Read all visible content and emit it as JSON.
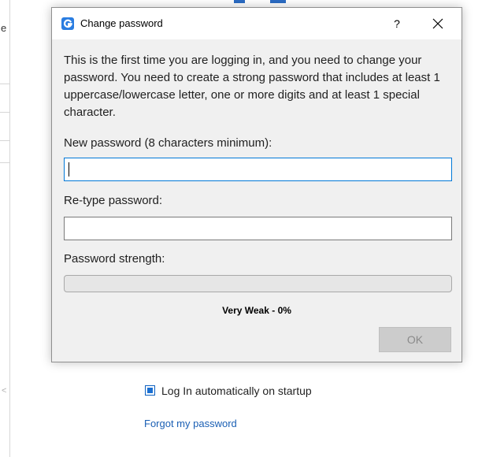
{
  "colors": {
    "accent": "#0078d7",
    "link": "#1a5fb4",
    "checkbox": "#1a6fd1",
    "app_icon": "#2a7de1"
  },
  "background": {
    "side_letter": "e",
    "side_arrow": "<"
  },
  "dialog": {
    "title": "Change password",
    "icon": "app-logo-icon",
    "help_label": "?",
    "close_icon": "close-icon",
    "message": "This is the first time you are logging in, and you need to change your password. You need to create a strong password that includes at least 1 uppercase/lowercase letter, one or more digits and at least 1 special character.",
    "new_password": {
      "label": "New password (8 characters minimum):",
      "value": ""
    },
    "retype_password": {
      "label": "Re-type password:",
      "value": ""
    },
    "strength": {
      "label": "Password strength:",
      "level": 0,
      "text": "Very Weak - 0%"
    },
    "ok_label": "OK"
  },
  "login": {
    "auto_login_label": "Log In automatically on startup",
    "auto_login_checked": true,
    "forgot_link": "Forgot my password"
  }
}
